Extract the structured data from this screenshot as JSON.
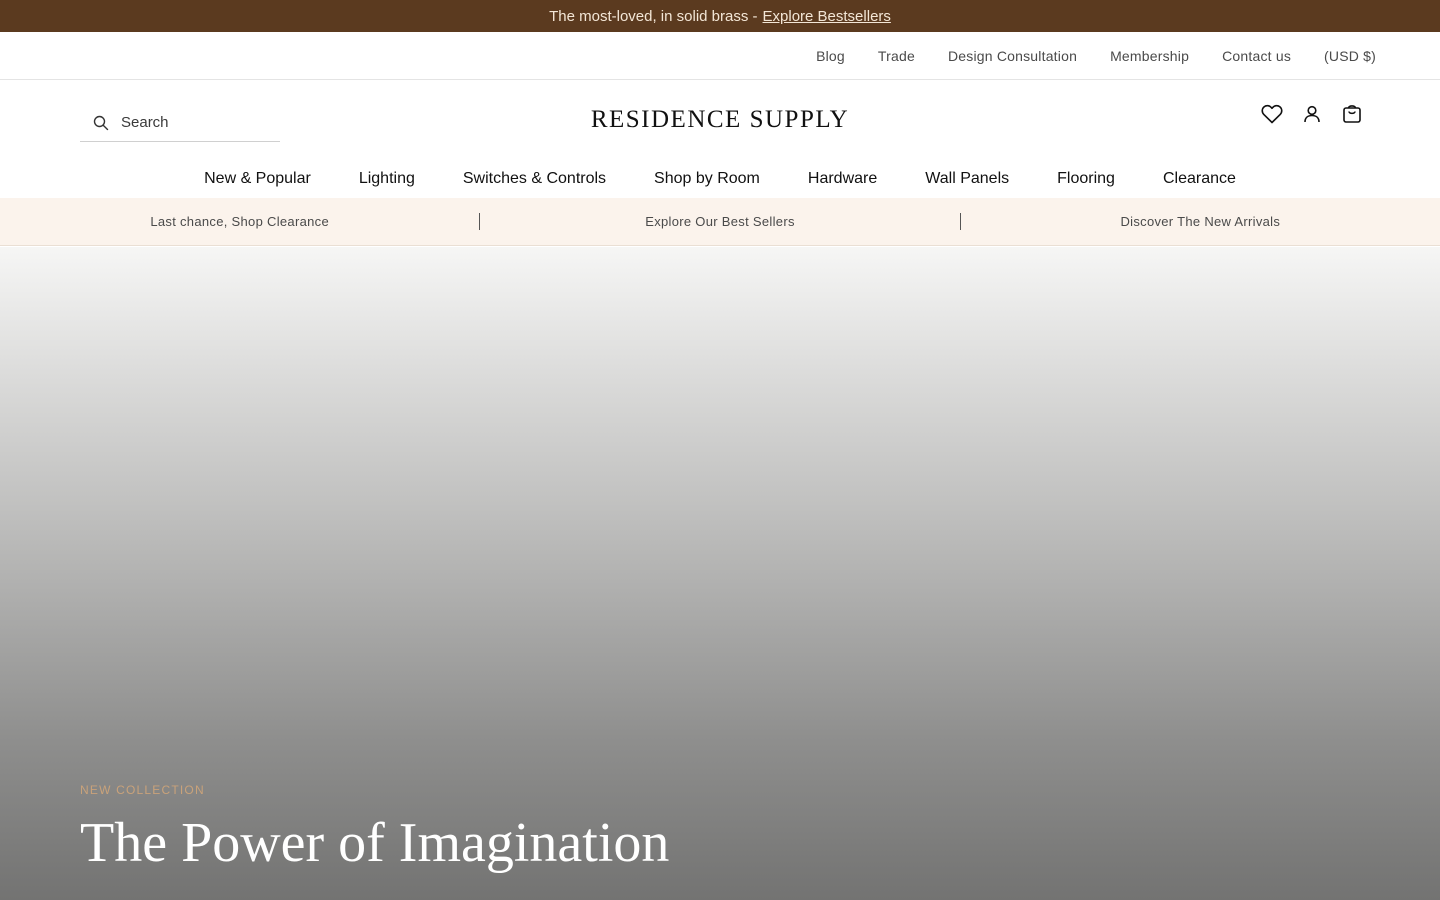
{
  "announcement": {
    "text": "The most-loved, in solid brass -",
    "link": "Explore Bestsellers"
  },
  "utility_nav": [
    "Blog",
    "Trade",
    "Design Consultation",
    "Membership",
    "Contact us",
    "(USD $)"
  ],
  "header": {
    "search_placeholder": "Search",
    "logo": "RESIDENCE SUPPLY",
    "icons": [
      "heart-icon",
      "account-icon",
      "cart-icon"
    ]
  },
  "main_nav": [
    "New & Popular",
    "Lighting",
    "Switches & Controls",
    "Shop by Room",
    "Hardware",
    "Wall Panels",
    "Flooring",
    "Clearance"
  ],
  "promo_bar": [
    "Last chance, Shop Clearance",
    "Explore Our Best Sellers",
    "Discover The New Arrivals"
  ],
  "hero": {
    "eyebrow": "NEW COLLECTION",
    "title": "The Power of Imagination"
  },
  "colors": {
    "announcement_bg": "#5b3a1f",
    "promo_bg": "#fbf3ec",
    "accent": "#c9a27a"
  }
}
